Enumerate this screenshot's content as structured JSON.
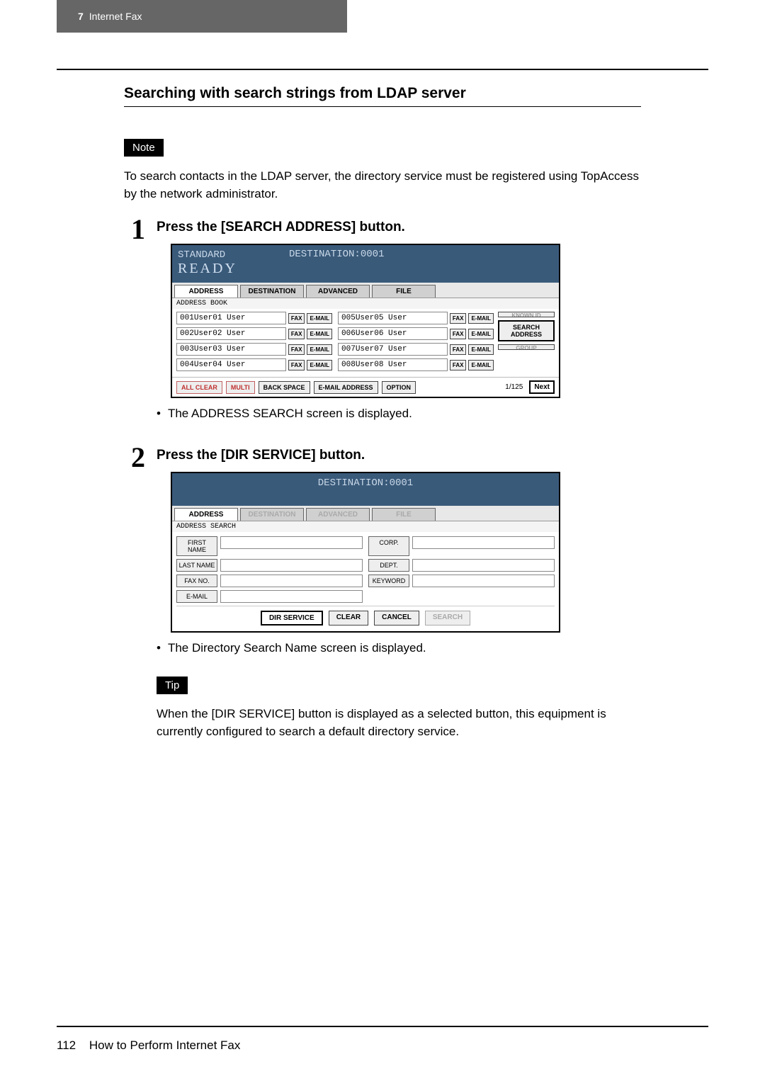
{
  "header": {
    "chapter": "7",
    "title": "Internet Fax"
  },
  "section_title": "Searching with search strings from LDAP server",
  "note": {
    "label": "Note",
    "text": "To search contacts in the LDAP server, the directory service must be registered using TopAccess by the network administrator."
  },
  "steps": [
    {
      "num": "1",
      "title": "Press the [SEARCH ADDRESS] button.",
      "bullet": "The ADDRESS SEARCH screen is displayed."
    },
    {
      "num": "2",
      "title": "Press the [DIR SERVICE] button.",
      "bullet": "The Directory Search Name screen is displayed."
    }
  ],
  "tip": {
    "label": "Tip",
    "text": "When the [DIR SERVICE] button is displayed as a selected button, this equipment is currently configured to search a default directory service."
  },
  "footer": {
    "page": "112",
    "text": "How to Perform Internet Fax"
  },
  "screen1": {
    "standard": "STANDARD",
    "destination": "DESTINATION:0001",
    "ready": "READY",
    "tabs": [
      "ADDRESS",
      "DESTINATION",
      "ADVANCED",
      "FILE"
    ],
    "subhead": "ADDRESS BOOK",
    "left_rows": [
      {
        "id": "001",
        "name": "User01 User"
      },
      {
        "id": "002",
        "name": "User02 User"
      },
      {
        "id": "003",
        "name": "User03 User"
      },
      {
        "id": "004",
        "name": "User04 User"
      }
    ],
    "right_rows": [
      {
        "id": "005",
        "name": "User05 User"
      },
      {
        "id": "006",
        "name": "User06 User"
      },
      {
        "id": "007",
        "name": "User07 User"
      },
      {
        "id": "008",
        "name": "User08 User"
      }
    ],
    "fax": "FAX",
    "email": "E-MAIL",
    "side": {
      "known": "KNOWN ID",
      "search": "SEARCH ADDRESS",
      "group": "GROUP"
    },
    "bottom": {
      "all_clear": "ALL CLEAR",
      "multi": "MULTI",
      "backspace": "BACK SPACE",
      "email_addr": "E-MAIL ADDRESS",
      "option": "OPTION",
      "page": "1/125",
      "next": "Next"
    }
  },
  "screen2": {
    "destination": "DESTINATION:0001",
    "tabs": [
      "ADDRESS",
      "DESTINATION",
      "ADVANCED",
      "FILE"
    ],
    "subhead": "ADDRESS SEARCH",
    "left_fields": [
      "FIRST NAME",
      "LAST NAME",
      "FAX NO.",
      "E-MAIL"
    ],
    "right_fields": [
      "CORP.",
      "DEPT.",
      "KEYWORD"
    ],
    "bottom": {
      "dir": "DIR SERVICE",
      "clear": "CLEAR",
      "cancel": "CANCEL",
      "search": "SEARCH"
    }
  }
}
